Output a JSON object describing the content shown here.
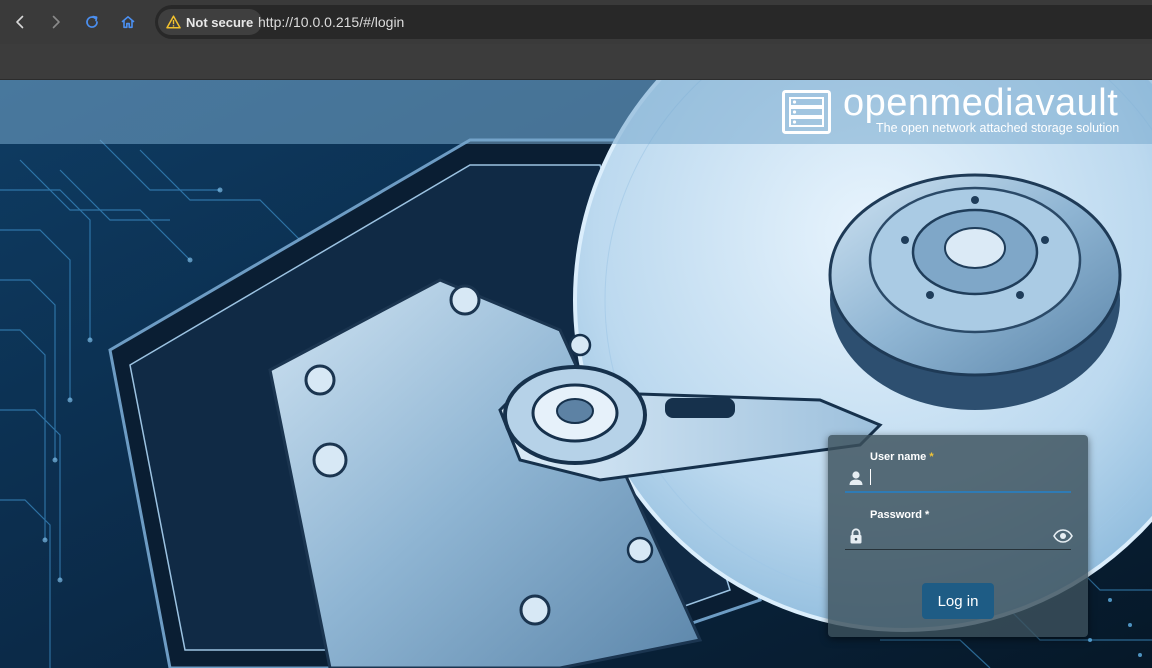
{
  "browser": {
    "back_icon": "chevron-left-icon",
    "forward_icon": "chevron-right-icon",
    "reload_icon": "reload-icon",
    "home_icon": "home-icon",
    "security_icon": "warning-triangle-icon",
    "security_label": "Not secure",
    "url": "http://10.0.0.215/#/login",
    "colors": {
      "toolbar": "#3a3a3a",
      "address_bar": "#282828",
      "warning": "#f2c12e",
      "home_accent": "#3b82f6"
    }
  },
  "header": {
    "logo_icon": "server-rack-icon",
    "brand_name": "openmediavault",
    "tagline": "The open network attached storage solution"
  },
  "login": {
    "username": {
      "icon": "user-icon",
      "label": "User name",
      "required_mark": "*",
      "value": ""
    },
    "password": {
      "icon": "lock-icon",
      "label": "Password",
      "required_mark": "*",
      "value": "",
      "toggle_icon": "eye-icon"
    },
    "submit_label": "Log in",
    "colors": {
      "button": "#1e5c85",
      "focus_underline": "#2f7bb5",
      "required_star": "#f0c437"
    }
  }
}
